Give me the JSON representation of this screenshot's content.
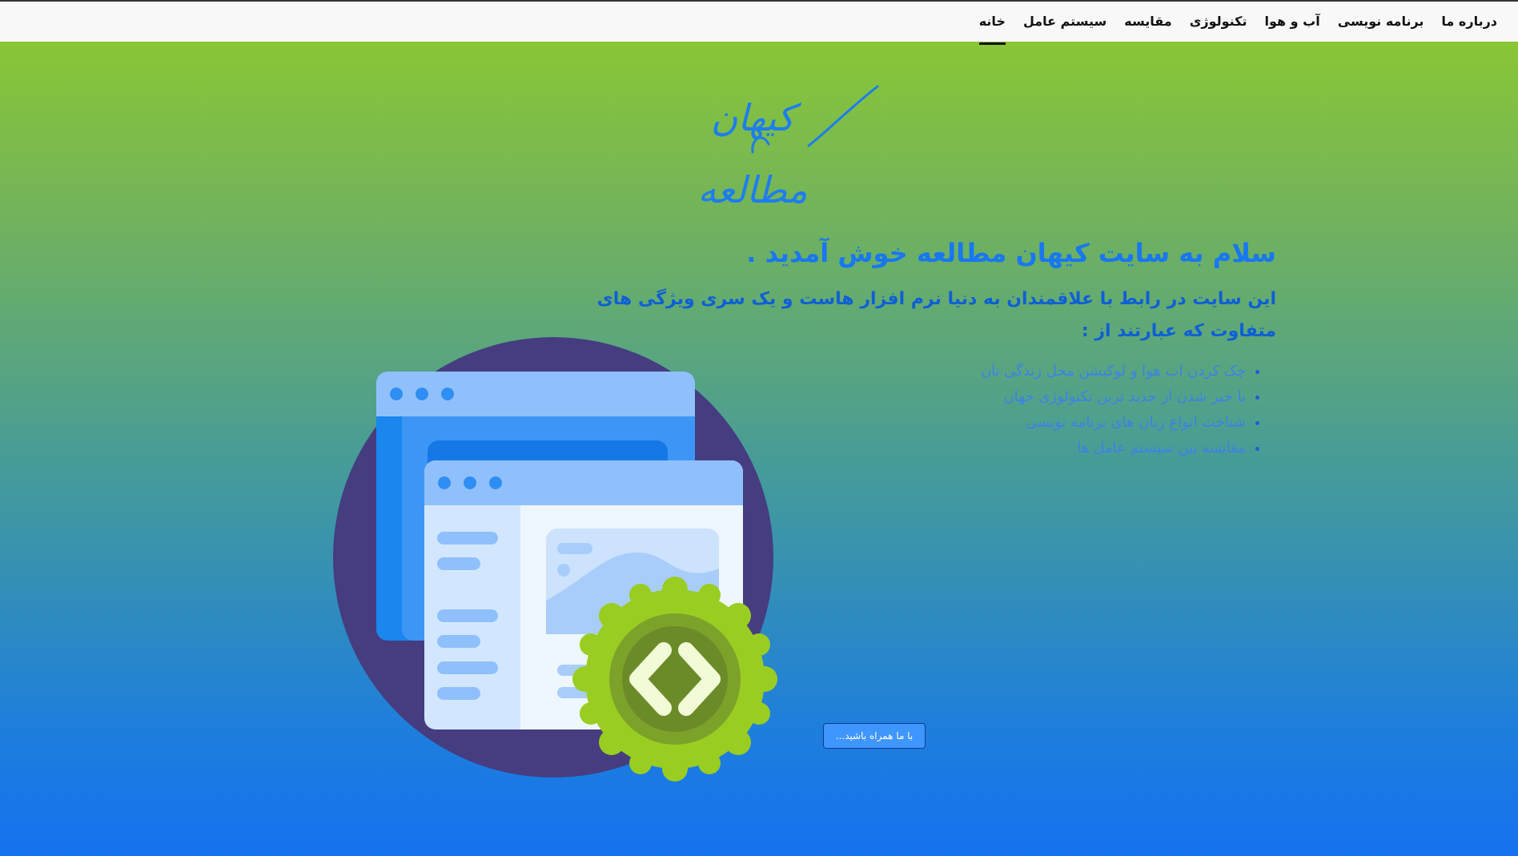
{
  "nav": {
    "items": [
      {
        "label": "خانه",
        "active": true
      },
      {
        "label": "سیستم عامل",
        "active": false
      },
      {
        "label": "مقایسه",
        "active": false
      },
      {
        "label": "تکنولوژی",
        "active": false
      },
      {
        "label": "آب و هوا",
        "active": false
      },
      {
        "label": "برنامه نویسی",
        "active": false
      },
      {
        "label": "درباره ما",
        "active": false
      }
    ]
  },
  "logo": {
    "text": "کیهان مطالعه"
  },
  "hero": {
    "welcome": "سلام به سایت کیهان مطالعه خوش آمدید .",
    "intro": "این سایت در رابط با علاقمندان به دنیا نرم افزار هاست و یک سری ویژگی های متفاوت که عبارتند از :",
    "features": [
      "چک کردن اب هوا و لوکیشن محل زندگی تان",
      "با خبر شدن از جدید ترین تکنولوژی جهان",
      "شناخت انواع زبان های برنامه نویسی",
      "مقایسه بین سیستم عامل ها"
    ]
  },
  "cta": {
    "label": "با ما همراه باشید..."
  },
  "colors": {
    "accent": "#1877f2",
    "gradient_top": "#8fcb2b",
    "gradient_bottom": "#1472ef",
    "illustration_circle": "#453d80",
    "gear": "#9acd22"
  },
  "icons": [
    "browser-windows-illustration",
    "code-gear-icon"
  ]
}
